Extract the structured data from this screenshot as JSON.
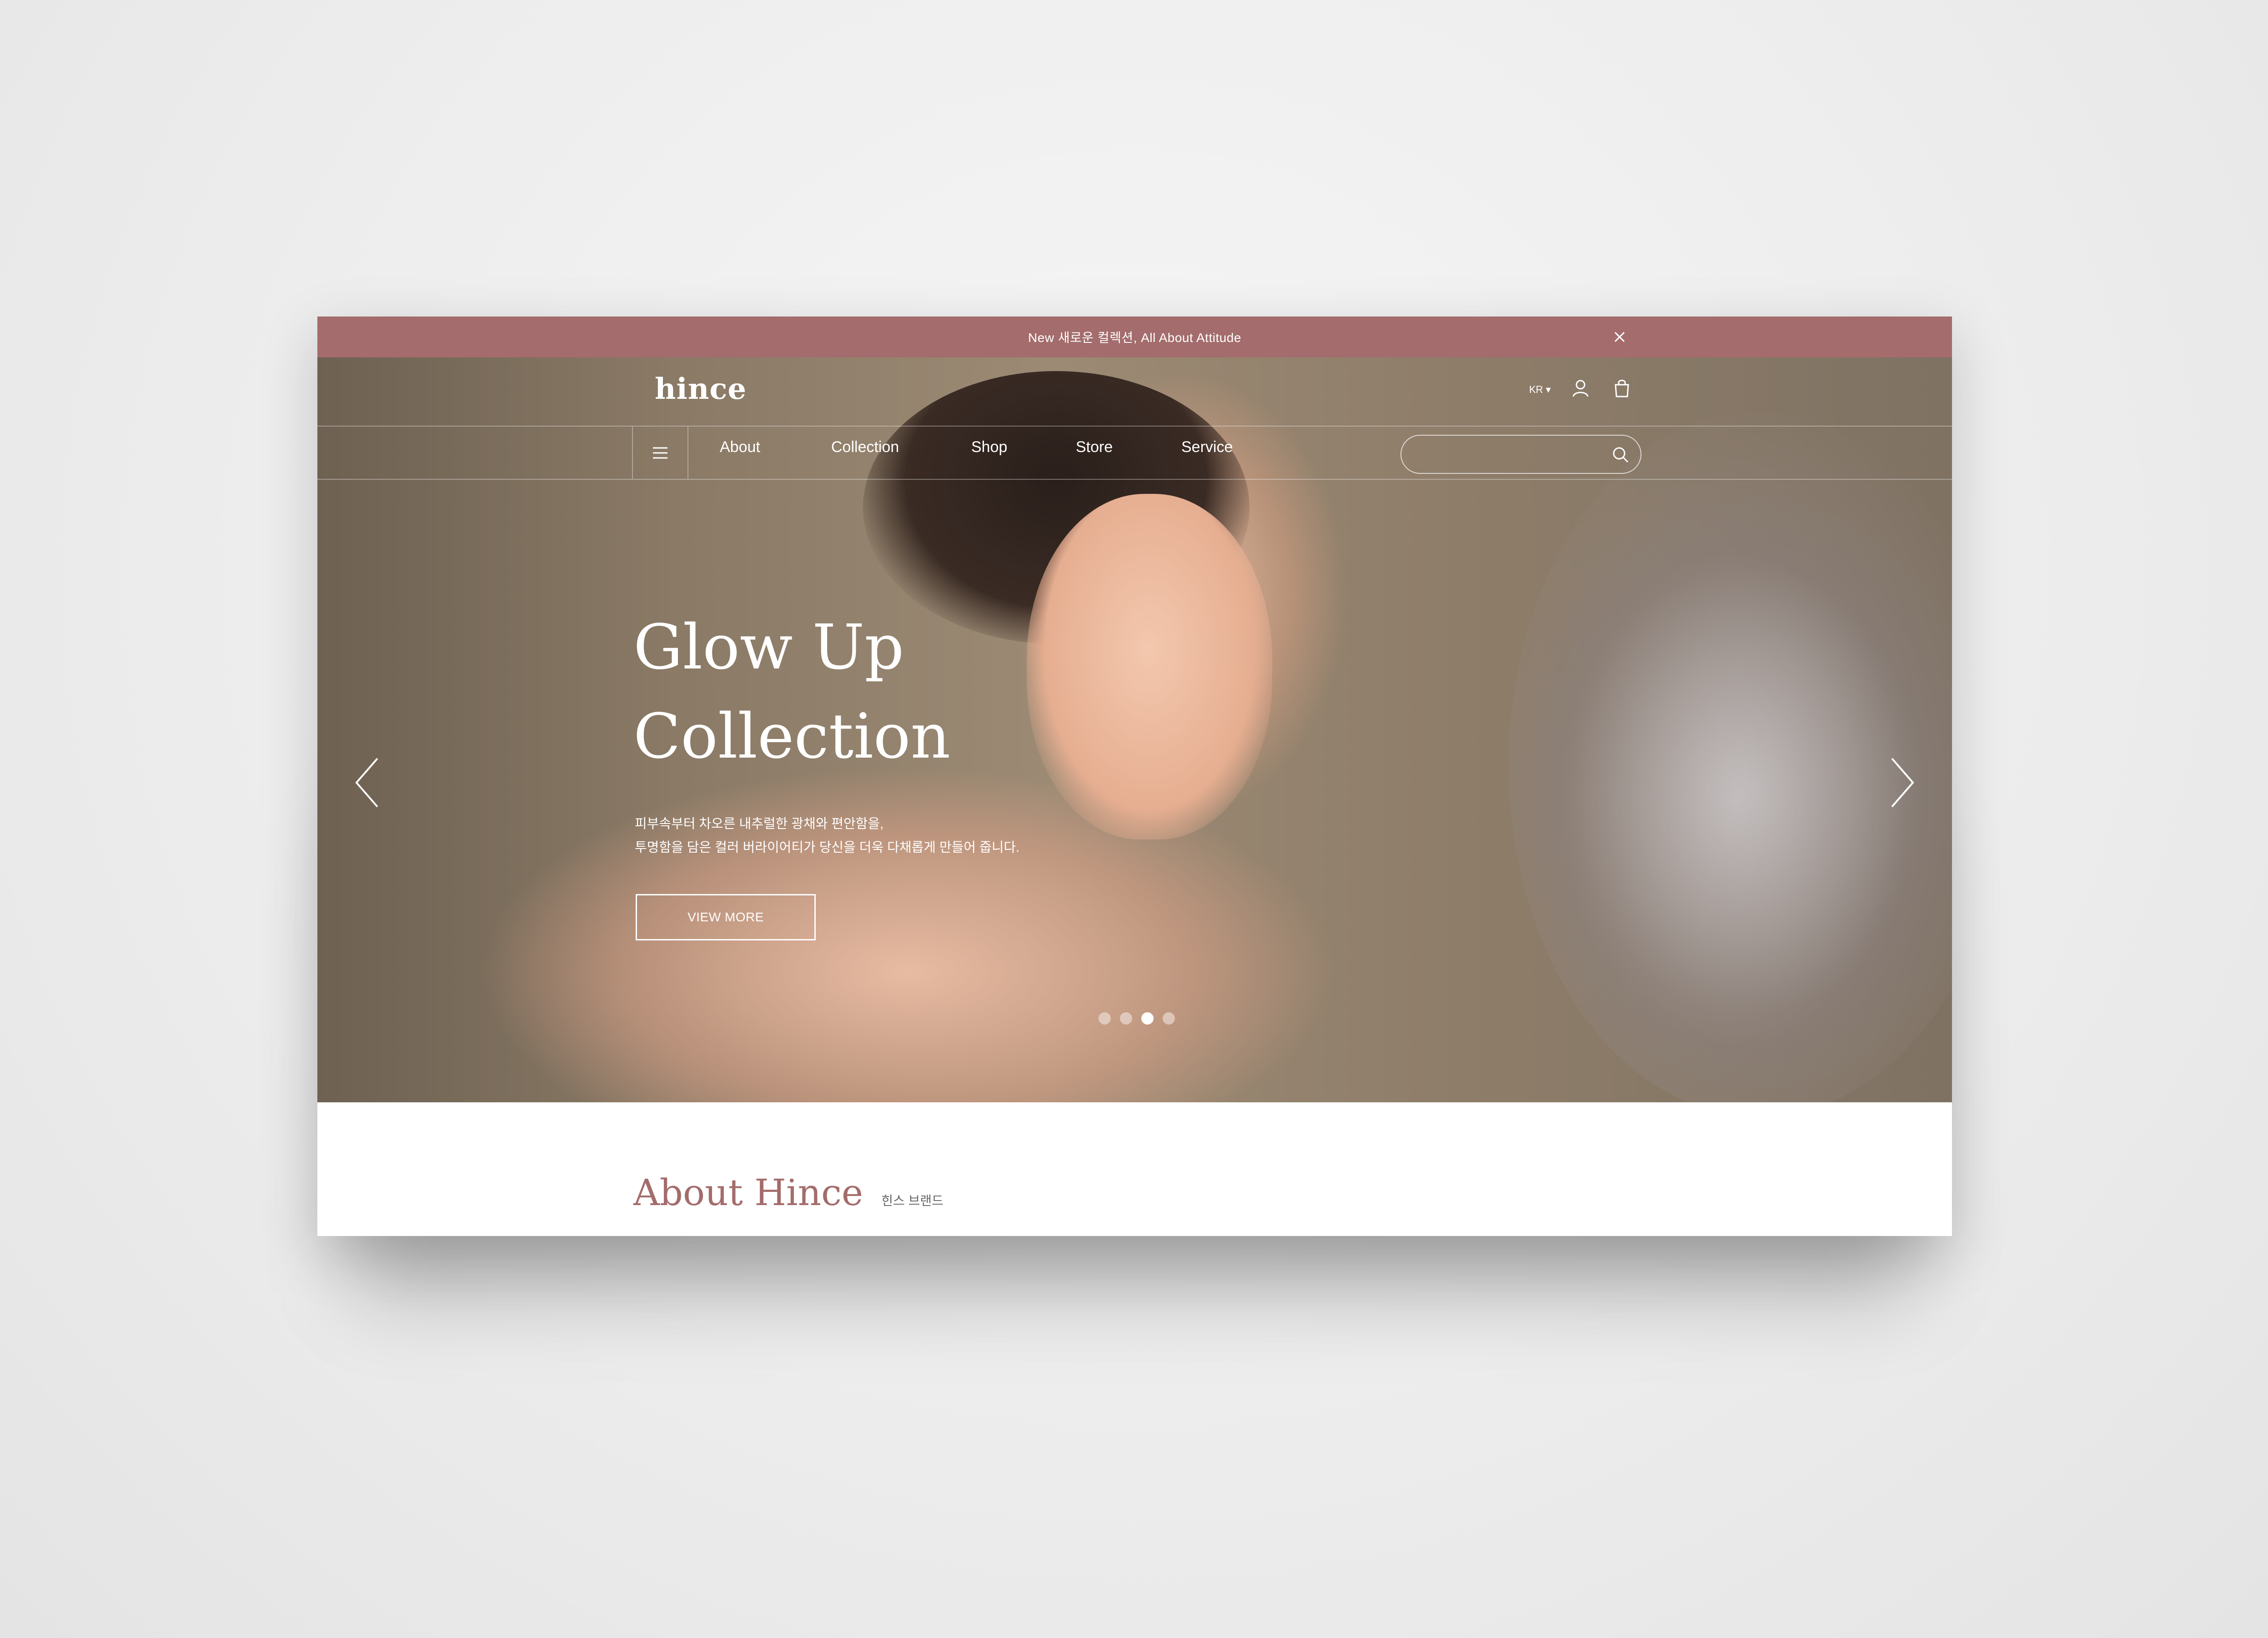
{
  "announcement": {
    "text": "New 새로운 컬렉션, All About Attitude",
    "close_icon": "close-icon"
  },
  "header": {
    "logo": "hince",
    "language": "KR",
    "icons": [
      "user-icon",
      "shopping-bag-icon"
    ]
  },
  "nav": {
    "menu_icon": "hamburger-menu-icon",
    "items": [
      {
        "label": "About"
      },
      {
        "label": "Collection"
      },
      {
        "label": "Shop"
      },
      {
        "label": "Store"
      },
      {
        "label": "Service"
      }
    ],
    "search": {
      "value": "",
      "placeholder": ""
    }
  },
  "hero": {
    "title_line1": "Glow Up",
    "title_line2": "Collection",
    "desc_line1": "피부속부터 차오른 내추럴한 광채와 편안함을,",
    "desc_line2": "투명함을 담은 컬러 버라이어티가 당신을 더욱 다채롭게 만들어 줍니다.",
    "cta": "VIEW MORE",
    "slides": {
      "count": 4,
      "active_index": 2
    }
  },
  "about": {
    "title": "About Hince",
    "subtitle": "힌스 브랜드"
  },
  "colors": {
    "accent": "#a46c6c",
    "text_on_hero": "#ffffff"
  }
}
